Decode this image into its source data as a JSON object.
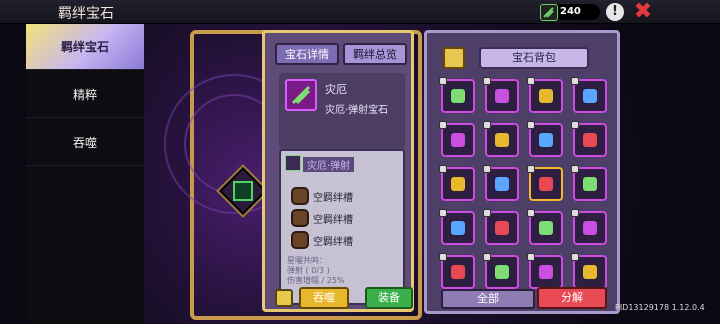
{
  "header": {
    "title": "羁绊宝石",
    "currency_value": "240",
    "currency_icon": "gem-currency-icon",
    "info_icon": "!",
    "close_icon": "✖"
  },
  "sidebar": {
    "items": [
      {
        "label": "羁绊宝石",
        "active": true
      },
      {
        "label": "精粹",
        "active": false
      },
      {
        "label": "吞噬",
        "active": false
      }
    ]
  },
  "details": {
    "tabs": [
      {
        "label": "宝石详情",
        "active": true
      },
      {
        "label": "羁绊总览",
        "active": false
      }
    ],
    "gem_name": "灾厄",
    "gem_type": "灾厄·弹射宝石",
    "effect_title": "灾厄·弹射",
    "slots": [
      "空羁绊槽",
      "空羁绊槽",
      "空羁绊槽"
    ],
    "bond_lines": [
      "星曜共鸣：",
      "弹射 ( 0/3 )",
      "伤害增幅 / 25%"
    ],
    "buttons": {
      "swallow": "吞噬",
      "equip": "装备"
    }
  },
  "bag": {
    "title": "宝石背包",
    "filter_label": "全部",
    "decompose_label": "分解"
  },
  "footer": {
    "pid": "PID13129178 1.12.0.4"
  },
  "colors": {
    "accent_gold": "#e6c870",
    "gem_purple": "#cf4be0",
    "equip_green": "#3bb04a",
    "decompose_red": "#e74a55"
  }
}
